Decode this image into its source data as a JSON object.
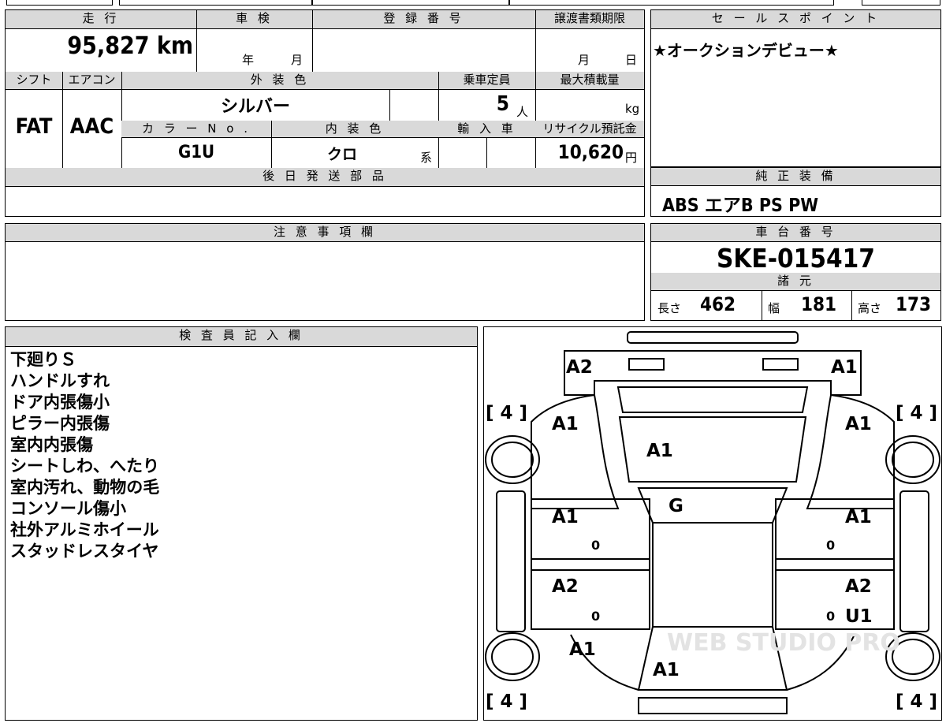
{
  "top_strip": {
    "fragments": [
      "■",
      "■",
      "■"
    ]
  },
  "vehicle_info": {
    "mileage_label": "走 行",
    "mileage_value": "95,827 km",
    "inspection_label": "車 検",
    "inspection_year": "年",
    "inspection_month": "月",
    "registration_label": "登 録 番 号",
    "transfer_deadline_label": "譲渡書類期限",
    "transfer_month": "月",
    "transfer_day": "日",
    "shift_label": "シフト",
    "shift_value": "FAT",
    "aircon_label": "エアコン",
    "aircon_value": "AAC",
    "exterior_color_label": "外 装 色",
    "exterior_color_value": "シルバー",
    "capacity_label": "乗車定員",
    "capacity_value": "5",
    "capacity_unit": "人",
    "max_load_label": "最大積載量",
    "max_load_unit": "kg",
    "color_no_label": "カ ラ ー N o .",
    "color_no_value": "G1U",
    "interior_color_label": "内 装 色",
    "interior_color_value": "クロ",
    "interior_color_suffix": "系",
    "import_label": "輸 入 車",
    "recycle_label": "リサイクル預託金",
    "recycle_value": "10,620",
    "recycle_unit": "円",
    "later_parts_label": "後 日 発 送 部 品"
  },
  "sales_point": {
    "label": "セ ー ル ス ポ イ ン ト",
    "text": "★オークションデビュー★"
  },
  "genuine_equipment": {
    "label": "純 正 装 備",
    "text": "ABS エアB PS PW"
  },
  "notes": {
    "label": "注 意 事 項 欄"
  },
  "chassis": {
    "label": "車 台 番 号",
    "value": "SKE-015417"
  },
  "specs": {
    "label": "諸 元",
    "length_label": "長さ",
    "length_value": "462",
    "width_label": "幅",
    "width_value": "181",
    "height_label": "高さ",
    "height_value": "173"
  },
  "inspector": {
    "label": "検 査 員 記 入 欄",
    "lines": [
      "下廻りＳ",
      "ハンドルすれ",
      "ドア内張傷小",
      "ピラー内張傷",
      "室内内張傷",
      "シートしわ、へたり",
      "室内汚れ、動物の毛",
      "コンソール傷小",
      "社外アルミホイール",
      "スタッドレスタイヤ"
    ]
  },
  "diagram": {
    "marks": {
      "front_left": "A2",
      "front_right": "A1",
      "fender_left": "A1",
      "fender_right": "A1",
      "hood": "A1",
      "windshield": "G",
      "front_door_left": "A1",
      "front_door_right": "A1",
      "rear_door_left": "A2",
      "rear_door_right": "A2",
      "rear_door_right_2": "U1",
      "quarter_left": "A1",
      "roof_rear": "A1",
      "sill_fl": "0",
      "sill_fr": "0",
      "sill_rl": "0",
      "sill_rr": "0"
    },
    "tire_tl": "[ 4 ]",
    "tire_tr": "[ 4 ]",
    "tire_bl": "[ 4 ]",
    "tire_br": "[ 4 ]",
    "watermark": "WEB STUDIO PRO"
  }
}
